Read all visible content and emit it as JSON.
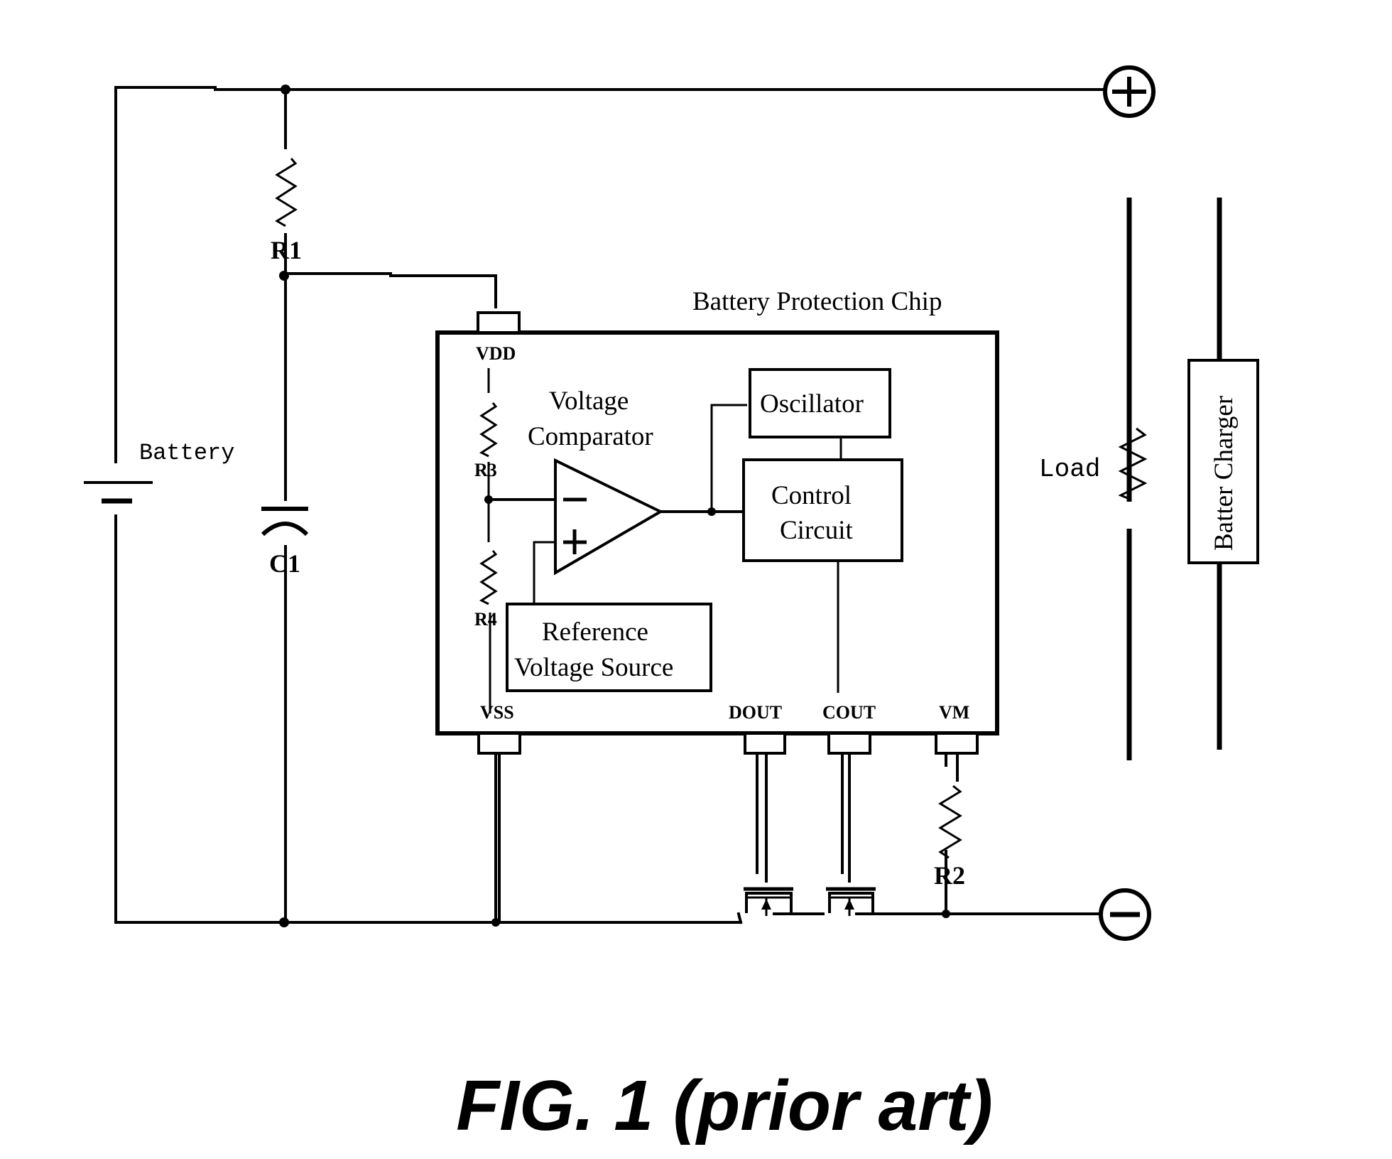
{
  "figure": {
    "caption": "FIG. 1 (prior art)"
  },
  "components": {
    "battery": {
      "label": "Battery"
    },
    "r1": {
      "label": "R1"
    },
    "c1": {
      "label": "C1"
    },
    "r2": {
      "label": "R2"
    },
    "r3": {
      "label": "R3"
    },
    "r4": {
      "label": "R4"
    },
    "load": {
      "label": "Load"
    },
    "charger": {
      "label": "Batter Charger"
    },
    "positive_terminal": {
      "symbol": "plus-terminal-icon"
    },
    "negative_terminal": {
      "symbol": "minus-terminal-icon"
    }
  },
  "chip": {
    "title": "Battery Protection Chip",
    "pins": {
      "vdd": "VDD",
      "vss": "VSS",
      "dout": "DOUT",
      "cout": "COUT",
      "vm": "VM"
    },
    "blocks": {
      "comparator_line1": "Voltage",
      "comparator_line2": "Comparator",
      "oscillator": "Oscillator",
      "control_line1": "Control",
      "control_line2": "Circuit",
      "reference_line1": "Reference",
      "reference_line2": "Voltage Source"
    }
  }
}
